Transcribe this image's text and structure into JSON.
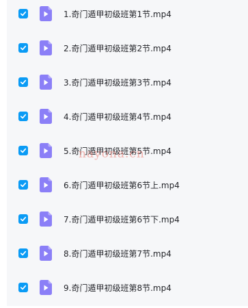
{
  "files": [
    {
      "name": "1.奇门遁甲初级班第1节.mp4",
      "checked": true,
      "icon": "video-file-icon"
    },
    {
      "name": "2.奇门遁甲初级班第2节.mp4",
      "checked": true,
      "icon": "video-file-icon"
    },
    {
      "name": "3.奇门遁甲初级班第3节.mp4",
      "checked": true,
      "icon": "video-file-icon"
    },
    {
      "name": "4.奇门遁甲初级班第4节.mp4",
      "checked": true,
      "icon": "video-file-icon"
    },
    {
      "name": "5.奇门遁甲初级班第5节.mp4",
      "checked": true,
      "icon": "video-file-icon"
    },
    {
      "name": "6.奇门遁甲初级班第6节上.mp4",
      "checked": true,
      "icon": "video-file-icon"
    },
    {
      "name": "7.奇门遁甲初级班第6节下.mp4",
      "checked": true,
      "icon": "video-file-icon"
    },
    {
      "name": "8.奇门遁甲初级班第7节.mp4",
      "checked": true,
      "icon": "video-file-icon"
    },
    {
      "name": "9.奇门遁甲初级班第8节.mp4",
      "checked": true,
      "icon": "video-file-icon"
    }
  ],
  "watermark": "nayona.cn",
  "colors": {
    "checkbox": "#0a9bf5",
    "file_icon": "#8b7ff7",
    "list_background": "#f6f7f9",
    "text": "#25262b"
  }
}
